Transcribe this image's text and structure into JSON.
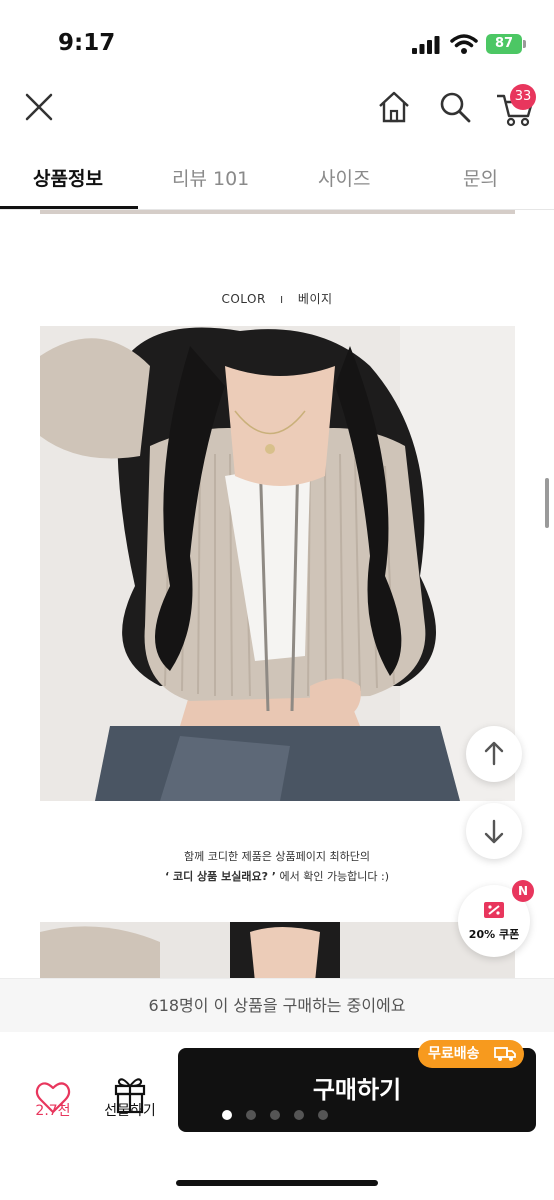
{
  "status_bar": {
    "time": "9:17",
    "battery": "87"
  },
  "header": {
    "cart_count": "33"
  },
  "tabs": [
    {
      "label": "상품정보"
    },
    {
      "label": "리뷰 101"
    },
    {
      "label": "사이즈"
    },
    {
      "label": "문의"
    }
  ],
  "product": {
    "color_label": "COLOR",
    "color_separator": "I",
    "color_value": "베이지",
    "caption_line1": "함께 코디한 제품은 상품페이지 최하단의",
    "caption_line2_bold": "‘ 코디 상품 보실래요? ’",
    "caption_line2_rest": " 에서 확인 가능합니다 :)"
  },
  "coupon": {
    "label": "20% 쿠폰",
    "badge": "N"
  },
  "buying_notice": "618명이 이 상품을 구매하는 중이에요",
  "actions": {
    "like_count": "2.7천",
    "gift_label": "선물하기",
    "buy_label": "구매하기",
    "free_shipping_label": "무료배송"
  },
  "pager": {
    "count": 5,
    "active": 0
  },
  "colors": {
    "accent": "#e8365d",
    "shipping": "#f79a1e",
    "buy_button": "#111111"
  },
  "icons": [
    "close-icon",
    "home-icon",
    "search-icon",
    "cart-icon",
    "arrow-up-icon",
    "arrow-down-icon",
    "coupon-icon",
    "heart-icon",
    "gift-icon",
    "truck-icon"
  ]
}
